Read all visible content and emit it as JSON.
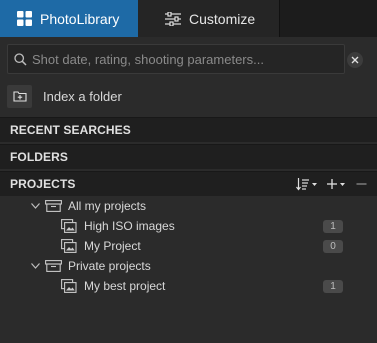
{
  "tabs": {
    "photolibrary": "PhotoLibrary",
    "customize": "Customize"
  },
  "search": {
    "placeholder": "Shot date, rating, shooting parameters...",
    "value": ""
  },
  "index": {
    "label": "Index a folder"
  },
  "sections": {
    "recent": "RECENT SEARCHES",
    "folders": "FOLDERS",
    "projects": "PROJECTS"
  },
  "tree": {
    "group1": {
      "label": "All my projects",
      "items": [
        {
          "label": "High ISO images",
          "count": "1"
        },
        {
          "label": "My Project",
          "count": "0"
        }
      ]
    },
    "group2": {
      "label": "Private projects",
      "items": [
        {
          "label": "My best project",
          "count": "1"
        }
      ]
    }
  },
  "colors": {
    "accent": "#1e6aa6",
    "background": "#2b2b2b",
    "section_bg": "#1f1f1f"
  },
  "icons": {
    "photolibrary_tab": "grid-icon",
    "customize_tab": "sliders-icon",
    "search": "search-icon",
    "clear": "close-icon",
    "index": "folder-add-icon",
    "sort": "sort-icon",
    "add": "plus-icon",
    "remove": "minus-icon",
    "group": "project-group-icon",
    "project": "project-icon"
  }
}
